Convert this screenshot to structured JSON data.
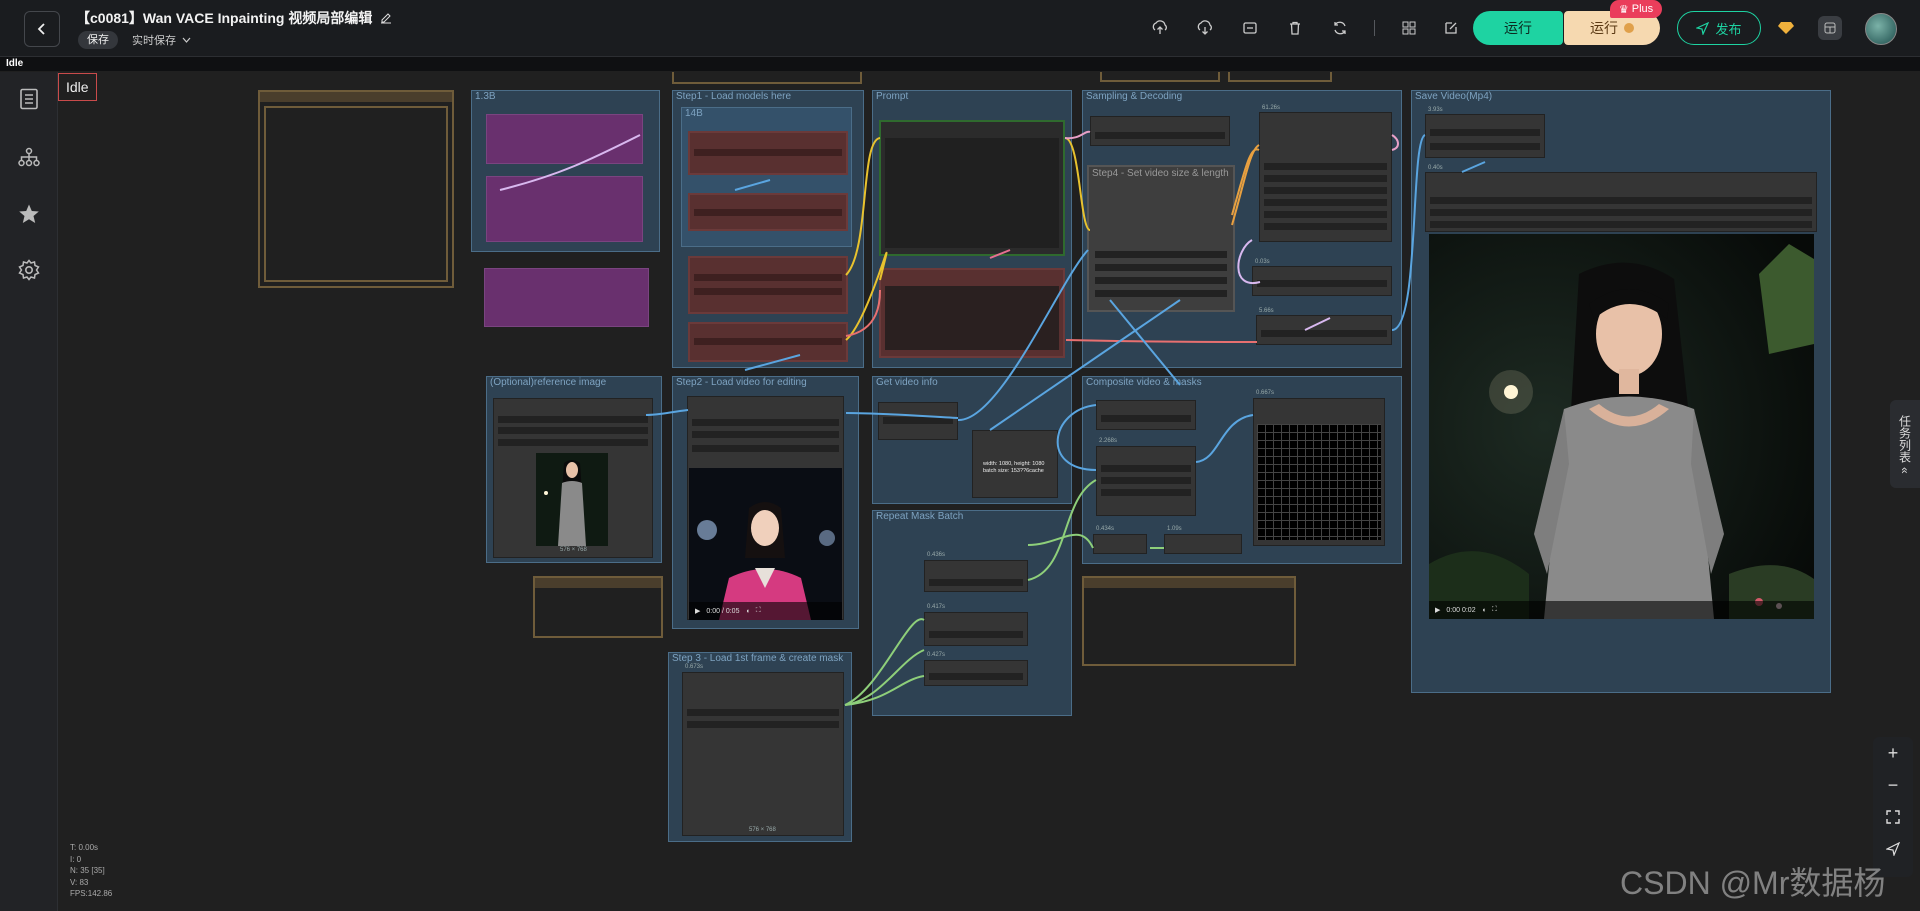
{
  "header": {
    "back_icon": "chevron-left-icon",
    "title": "【c0081】Wan VACE Inpainting 视频局部编辑",
    "save_label": "保存",
    "autosave_label": "实时保存",
    "run_label": "运行",
    "run_plus_label": "运行",
    "plus_badge": "Plus",
    "publish_label": "发布",
    "toolbar_icons": [
      "upload-icon",
      "download-icon",
      "export-icon",
      "trash-icon",
      "refresh-icon",
      "grid-icon",
      "edit-icon"
    ]
  },
  "subbar": {
    "status": "Idle"
  },
  "sidebar": {
    "icons": [
      "document-icon",
      "sitemap-icon",
      "star-icon",
      "gear-icon"
    ]
  },
  "canvas": {
    "idle": "Idle",
    "groups": {
      "g13b": "1.3B",
      "step1": "Step1 - Load models here",
      "g14b": "14B",
      "prompt": "Prompt",
      "sampling": "Sampling & Decoding",
      "step4": "Step4 - Set video size & length",
      "save_video": "Save Video(Mp4)",
      "ref_image": "(Optional)reference image",
      "step2": "Step2 - Load video for editing",
      "video_info": "Get video info",
      "composite": "Composite video & masks",
      "repeat_mask": "Repeat Mask Batch",
      "step3": "Step 3 - Load 1st frame & create mask"
    },
    "info_text": "width: 1080, height: 1080\nbatch size: 153??6cache",
    "image_size_label": "576 × 768",
    "step2_video_time": "0:00 / 0:05",
    "save_video_time": "0:00 0:02",
    "node_timings": [
      "3.93s",
      "0.40s",
      "61.26s",
      "0.03s",
      "5.66s",
      "0.667s",
      "2.268s",
      "0.434s",
      "1.09s",
      "0.436s",
      "0.417s",
      "0.427s",
      "0.673s"
    ]
  },
  "right_panel": {
    "task_list": "任务列表"
  },
  "zoom": {
    "icons": [
      "plus-icon",
      "minus-icon",
      "fit-icon",
      "send-icon"
    ]
  },
  "stats": [
    "T: 0.00s",
    "I: 0",
    "N: 35 [35]",
    "V: 83",
    "FPS:142.86"
  ],
  "watermark": "CSDN @Mr数据杨",
  "colors": {
    "accent": "#1ed3a2",
    "plus": "#ea3d5b",
    "group": "#3a5f7d",
    "frame": "#6f5c3a"
  }
}
